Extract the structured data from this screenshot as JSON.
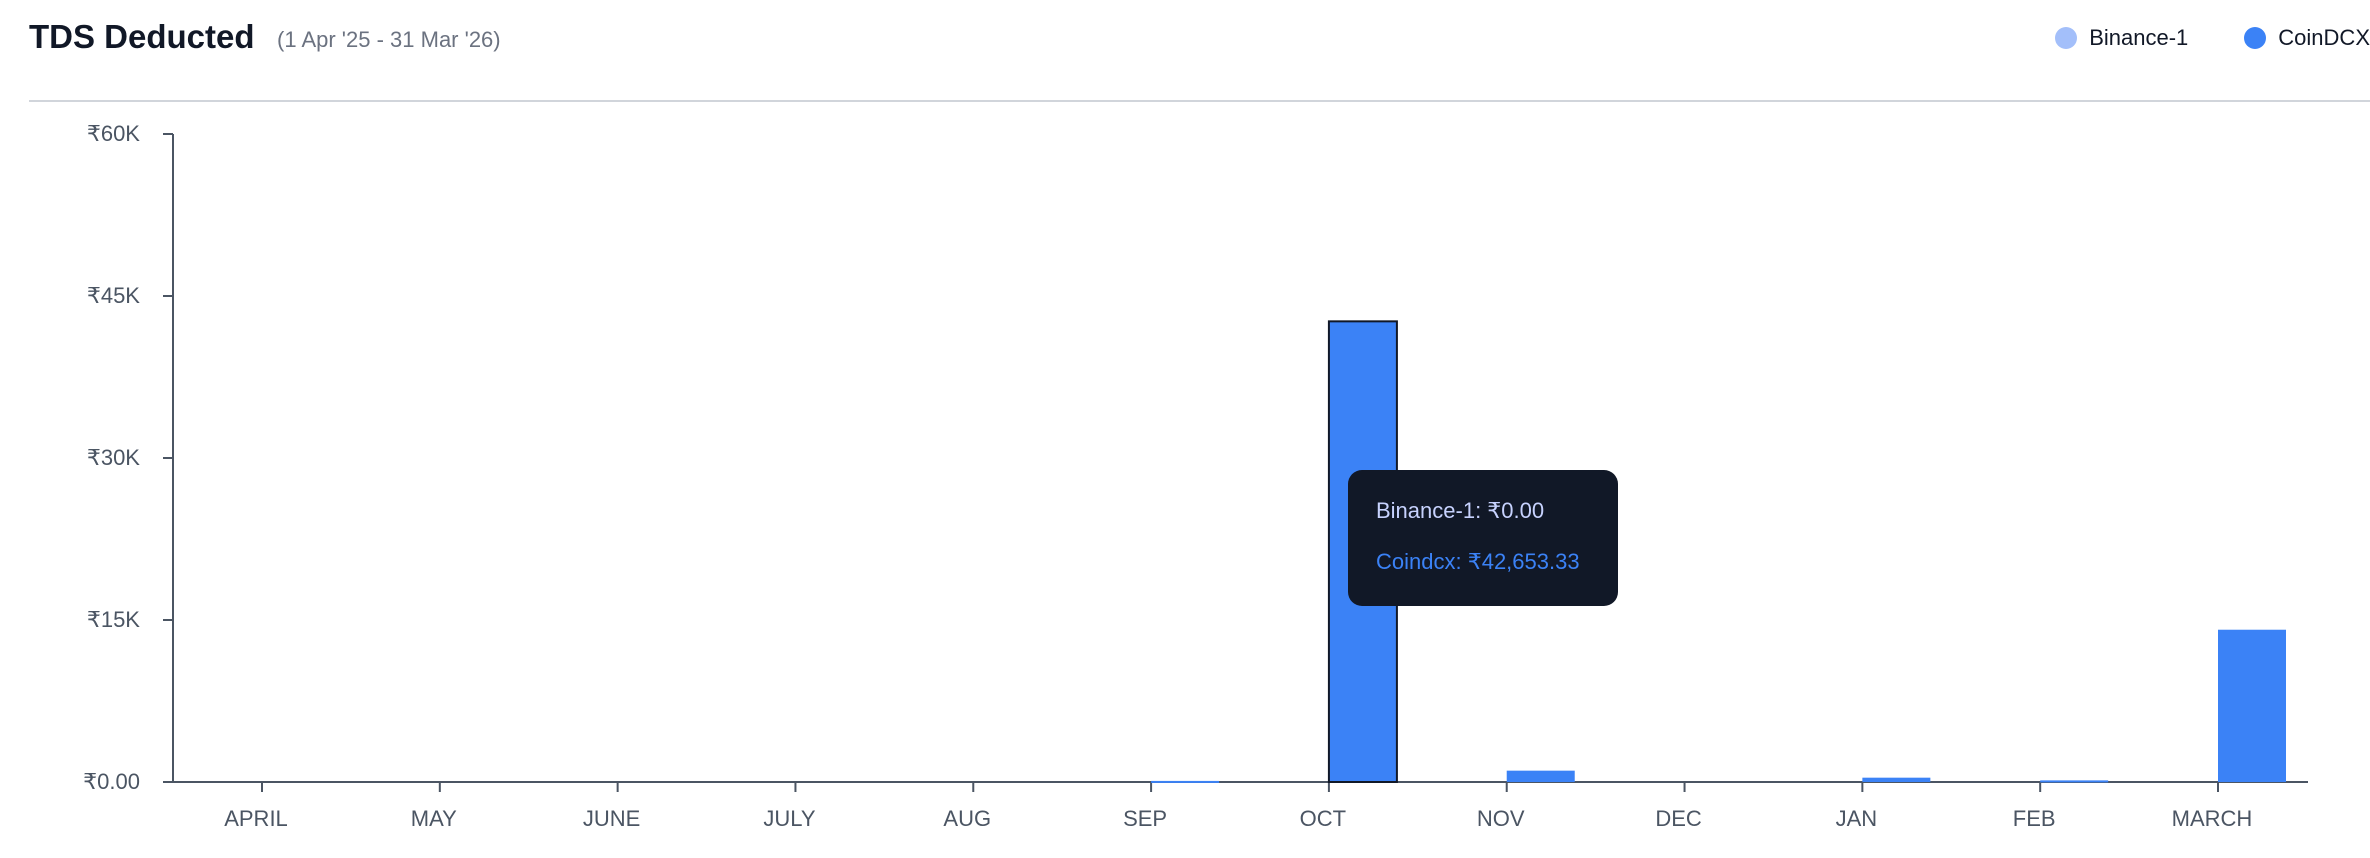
{
  "header": {
    "title": "TDS Deducted",
    "subtitle": "(1 Apr '25 - 31 Mar '26)"
  },
  "legend": [
    {
      "label": "Binance-1",
      "color": "#a3bffa"
    },
    {
      "label": "CoinDCX",
      "color": "#3b82f6"
    }
  ],
  "tooltip": {
    "lines": [
      {
        "text": "Binance-1: ₹0.00",
        "color": "#c7d2fe"
      },
      {
        "text": "Coindcx: ₹42,653.33",
        "color": "#3b82f6"
      }
    ]
  },
  "chart_data": {
    "type": "bar",
    "title": "TDS Deducted",
    "categories": [
      "APRIL",
      "MAY",
      "JUNE",
      "JULY",
      "AUG",
      "SEP",
      "OCT",
      "NOV",
      "DEC",
      "JAN",
      "FEB",
      "MARCH"
    ],
    "series": [
      {
        "name": "Binance-1",
        "color": "#a3bffa",
        "values": [
          0,
          0,
          0,
          0,
          0,
          0,
          0,
          0,
          0,
          0,
          0,
          0
        ]
      },
      {
        "name": "CoinDCX",
        "color": "#3b82f6",
        "values": [
          0,
          0,
          0,
          0,
          0,
          100,
          42653.33,
          1050,
          0,
          400,
          150,
          14100
        ]
      }
    ],
    "yticks": [
      {
        "value": 0,
        "label": "₹0.00"
      },
      {
        "value": 15000,
        "label": "₹15K"
      },
      {
        "value": 30000,
        "label": "₹30K"
      },
      {
        "value": 45000,
        "label": "₹45K"
      },
      {
        "value": 60000,
        "label": "₹60K"
      }
    ],
    "ylim": [
      0,
      60000
    ],
    "highlighted_category": "OCT",
    "grid": false,
    "legend_position": "top-right"
  }
}
